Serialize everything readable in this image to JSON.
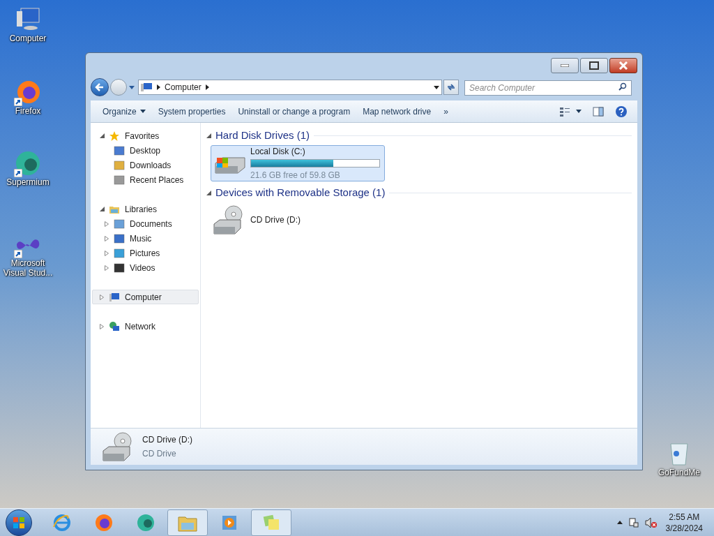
{
  "desktop_icons": [
    {
      "label": "Computer",
      "shortcut": false
    },
    {
      "label": "Firefox",
      "shortcut": true
    },
    {
      "label": "Supermium",
      "shortcut": true
    },
    {
      "label": "Microsoft Visual Stud...",
      "shortcut": true
    },
    {
      "label": "GoFundMe",
      "shortcut": false
    }
  ],
  "window": {
    "address": [
      "Computer"
    ],
    "search": {
      "placeholder": "Search Computer"
    },
    "toolbar": [
      {
        "label": "Organize",
        "dropdown": true
      },
      {
        "label": "System properties",
        "dropdown": false
      },
      {
        "label": "Uninstall or change a program",
        "dropdown": false
      },
      {
        "label": "Map network drive",
        "dropdown": false
      },
      {
        "label": "»",
        "dropdown": false
      }
    ],
    "nav": [
      {
        "label": "Favorites",
        "expanded": true,
        "selected": false,
        "children": [
          {
            "label": "Desktop",
            "selected": false
          },
          {
            "label": "Downloads",
            "selected": false
          },
          {
            "label": "Recent Places",
            "selected": false
          }
        ]
      },
      {
        "label": "Libraries",
        "expanded": true,
        "selected": false,
        "children": [
          {
            "label": "Documents",
            "selected": false,
            "expanded": false
          },
          {
            "label": "Music",
            "selected": false,
            "expanded": false
          },
          {
            "label": "Pictures",
            "selected": false,
            "expanded": false
          },
          {
            "label": "Videos",
            "selected": false,
            "expanded": false
          }
        ]
      },
      {
        "label": "Computer",
        "expanded": false,
        "selected": true
      },
      {
        "label": "Network",
        "expanded": false,
        "selected": false
      }
    ],
    "groups": [
      {
        "title": "Hard Disk Drives (1)",
        "expanded": true,
        "items": [
          {
            "kind": "disk",
            "name": "Local Disk (C:)",
            "level": 0.64,
            "info": "21.6 GB free of 59.8 GB",
            "selected": true
          }
        ]
      },
      {
        "title": "Devices with Removable Storage (1)",
        "expanded": true,
        "items": [
          {
            "kind": "cd",
            "name": "CD Drive (D:)",
            "selected": false
          }
        ]
      }
    ],
    "details": {
      "name": "CD Drive (D:)",
      "type": "CD Drive"
    }
  },
  "taskbar": {
    "apps": [
      {
        "running": false
      },
      {
        "running": false
      },
      {
        "running": false
      },
      {
        "running": true
      },
      {
        "running": false
      },
      {
        "running": true
      }
    ],
    "time": "2:55 AM",
    "date": "3/28/2024"
  }
}
